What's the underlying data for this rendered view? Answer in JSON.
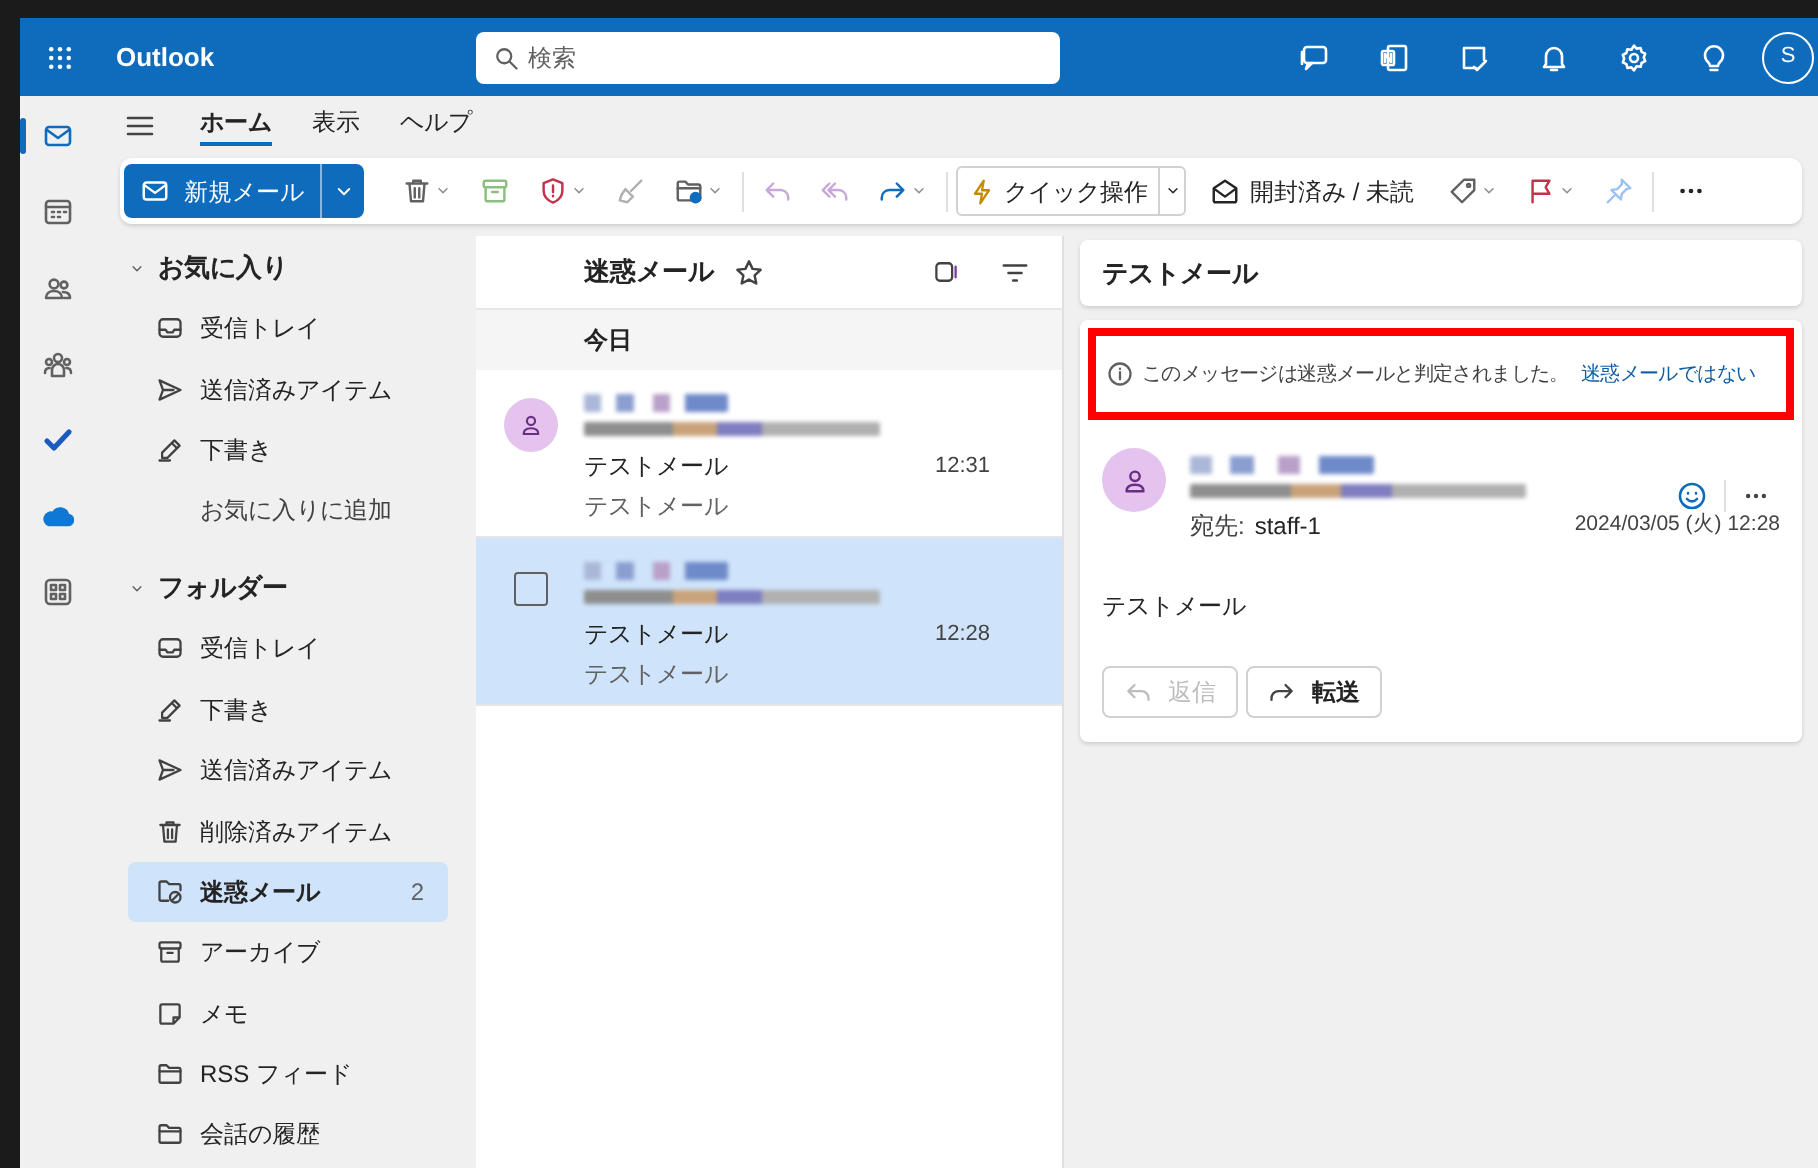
{
  "app": {
    "name": "Outlook"
  },
  "search": {
    "placeholder": "検索"
  },
  "account": {
    "initial": "S"
  },
  "rail": [
    {
      "kind": "mail",
      "selected": true
    },
    {
      "kind": "calendar",
      "selected": false
    },
    {
      "kind": "people",
      "selected": false
    },
    {
      "kind": "groups",
      "selected": false
    },
    {
      "kind": "todo",
      "selected": false
    },
    {
      "kind": "cloud",
      "selected": false
    },
    {
      "kind": "apps",
      "selected": false
    }
  ],
  "ribbon_tabs": [
    {
      "label": "ホーム",
      "selected": true
    },
    {
      "label": "表示",
      "selected": false
    },
    {
      "label": "ヘルプ",
      "selected": false
    }
  ],
  "toolbar": {
    "new_mail": "新規メール",
    "quick_steps": "クイック操作",
    "read_unread": "開封済み / 未読"
  },
  "favorites": {
    "title": "お気に入り",
    "expanded": true,
    "add_link": "お気に入りに追加",
    "items": [
      {
        "label": "受信トレイ",
        "kind": "inbox"
      },
      {
        "label": "送信済みアイテム",
        "kind": "sent"
      },
      {
        "label": "下書き",
        "kind": "drafts"
      }
    ]
  },
  "folders": {
    "title": "フォルダー",
    "expanded": true,
    "items": [
      {
        "label": "受信トレイ",
        "kind": "inbox",
        "selected": false
      },
      {
        "label": "下書き",
        "kind": "drafts",
        "selected": false
      },
      {
        "label": "送信済みアイテム",
        "kind": "sent",
        "selected": false
      },
      {
        "label": "削除済みアイテム",
        "kind": "deleted",
        "selected": false
      },
      {
        "label": "迷惑メール",
        "kind": "junk",
        "selected": true,
        "count": "2"
      },
      {
        "label": "アーカイブ",
        "kind": "archive",
        "selected": false
      },
      {
        "label": "メモ",
        "kind": "notes",
        "selected": false
      },
      {
        "label": "RSS フィード",
        "kind": "folder",
        "selected": false
      },
      {
        "label": "会話の履歴",
        "kind": "folder",
        "selected": false
      }
    ]
  },
  "message_list": {
    "title": "迷惑メール",
    "group": "今日",
    "messages": [
      {
        "subject": "テストメール",
        "preview": "テストメール",
        "time": "12:31",
        "selected": false
      },
      {
        "subject": "テストメール",
        "preview": "テストメール",
        "time": "12:28",
        "selected": true
      }
    ]
  },
  "reading_pane": {
    "subject": "テストメール",
    "notice": {
      "text": "このメッセージは迷惑メールと判定されました。",
      "link": "迷惑メールではない",
      "highlighted": true
    },
    "to_label": "宛先:",
    "to": "staff-1",
    "date": "2024/03/05 (火) 12:28",
    "body": "テストメール",
    "actions": [
      {
        "kind": "reply",
        "label": "返信",
        "disabled": true
      },
      {
        "kind": "forward",
        "label": "転送",
        "disabled": false
      }
    ]
  }
}
